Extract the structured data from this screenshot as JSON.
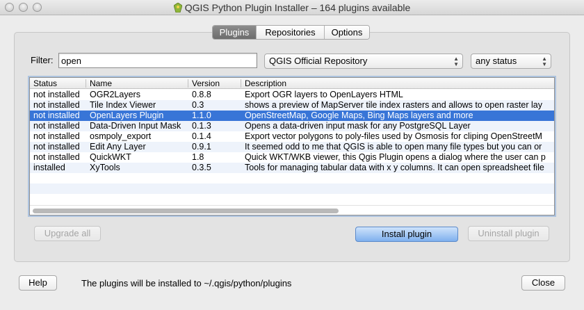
{
  "window": {
    "title": "QGIS Python Plugin Installer – 164 plugins available"
  },
  "tabs": [
    {
      "label": "Plugins",
      "active": true
    },
    {
      "label": "Repositories",
      "active": false
    },
    {
      "label": "Options",
      "active": false
    }
  ],
  "filter": {
    "label": "Filter:",
    "value": "open",
    "repository": "QGIS Official Repository",
    "status": "any status"
  },
  "table": {
    "columns": [
      "Status",
      "Name",
      "Version",
      "Description"
    ],
    "rows": [
      {
        "status": "not installed",
        "name": "OGR2Layers",
        "version": "0.8.8",
        "description": "Export OGR layers to OpenLayers HTML",
        "selected": false
      },
      {
        "status": "not installed",
        "name": "Tile Index Viewer",
        "version": "0.3",
        "description": "shows a preview of MapServer tile index rasters and allows to open raster lay",
        "selected": false
      },
      {
        "status": "not installed",
        "name": "OpenLayers Plugin",
        "version": "1.1.0",
        "description": "OpenStreetMap, Google Maps, Bing Maps layers and more",
        "selected": true
      },
      {
        "status": "not installed",
        "name": "Data-Driven Input Mask",
        "version": "0.1.3",
        "description": "Opens a data-driven input mask for any PostgreSQL Layer",
        "selected": false
      },
      {
        "status": "not installed",
        "name": "osmpoly_export",
        "version": "0.1.4",
        "description": "Export vector polygons to poly-files used by Osmosis for cliping OpenStreetM",
        "selected": false
      },
      {
        "status": "not installed",
        "name": "Edit Any Layer",
        "version": "0.9.1",
        "description": "It seemed odd to me that QGIS is able to open many file types but you can or",
        "selected": false
      },
      {
        "status": "not installed",
        "name": "QuickWKT",
        "version": "1.8",
        "description": "Quick WKT/WKB viewer, this Qgis Plugin opens a dialog where the user can p",
        "selected": false
      },
      {
        "status": "installed",
        "name": "XyTools",
        "version": "0.3.5",
        "description": "Tools for managing tabular data with x y columns. It can open spreadsheet file",
        "selected": false
      }
    ]
  },
  "buttons": {
    "upgrade_all": "Upgrade all",
    "install": "Install plugin",
    "uninstall": "Uninstall plugin",
    "help": "Help",
    "close": "Close"
  },
  "status_text": "The plugins will be installed to ~/.qgis/python/plugins",
  "colors": {
    "selection": "#3875d7",
    "default_button": "#7fb0ee"
  }
}
